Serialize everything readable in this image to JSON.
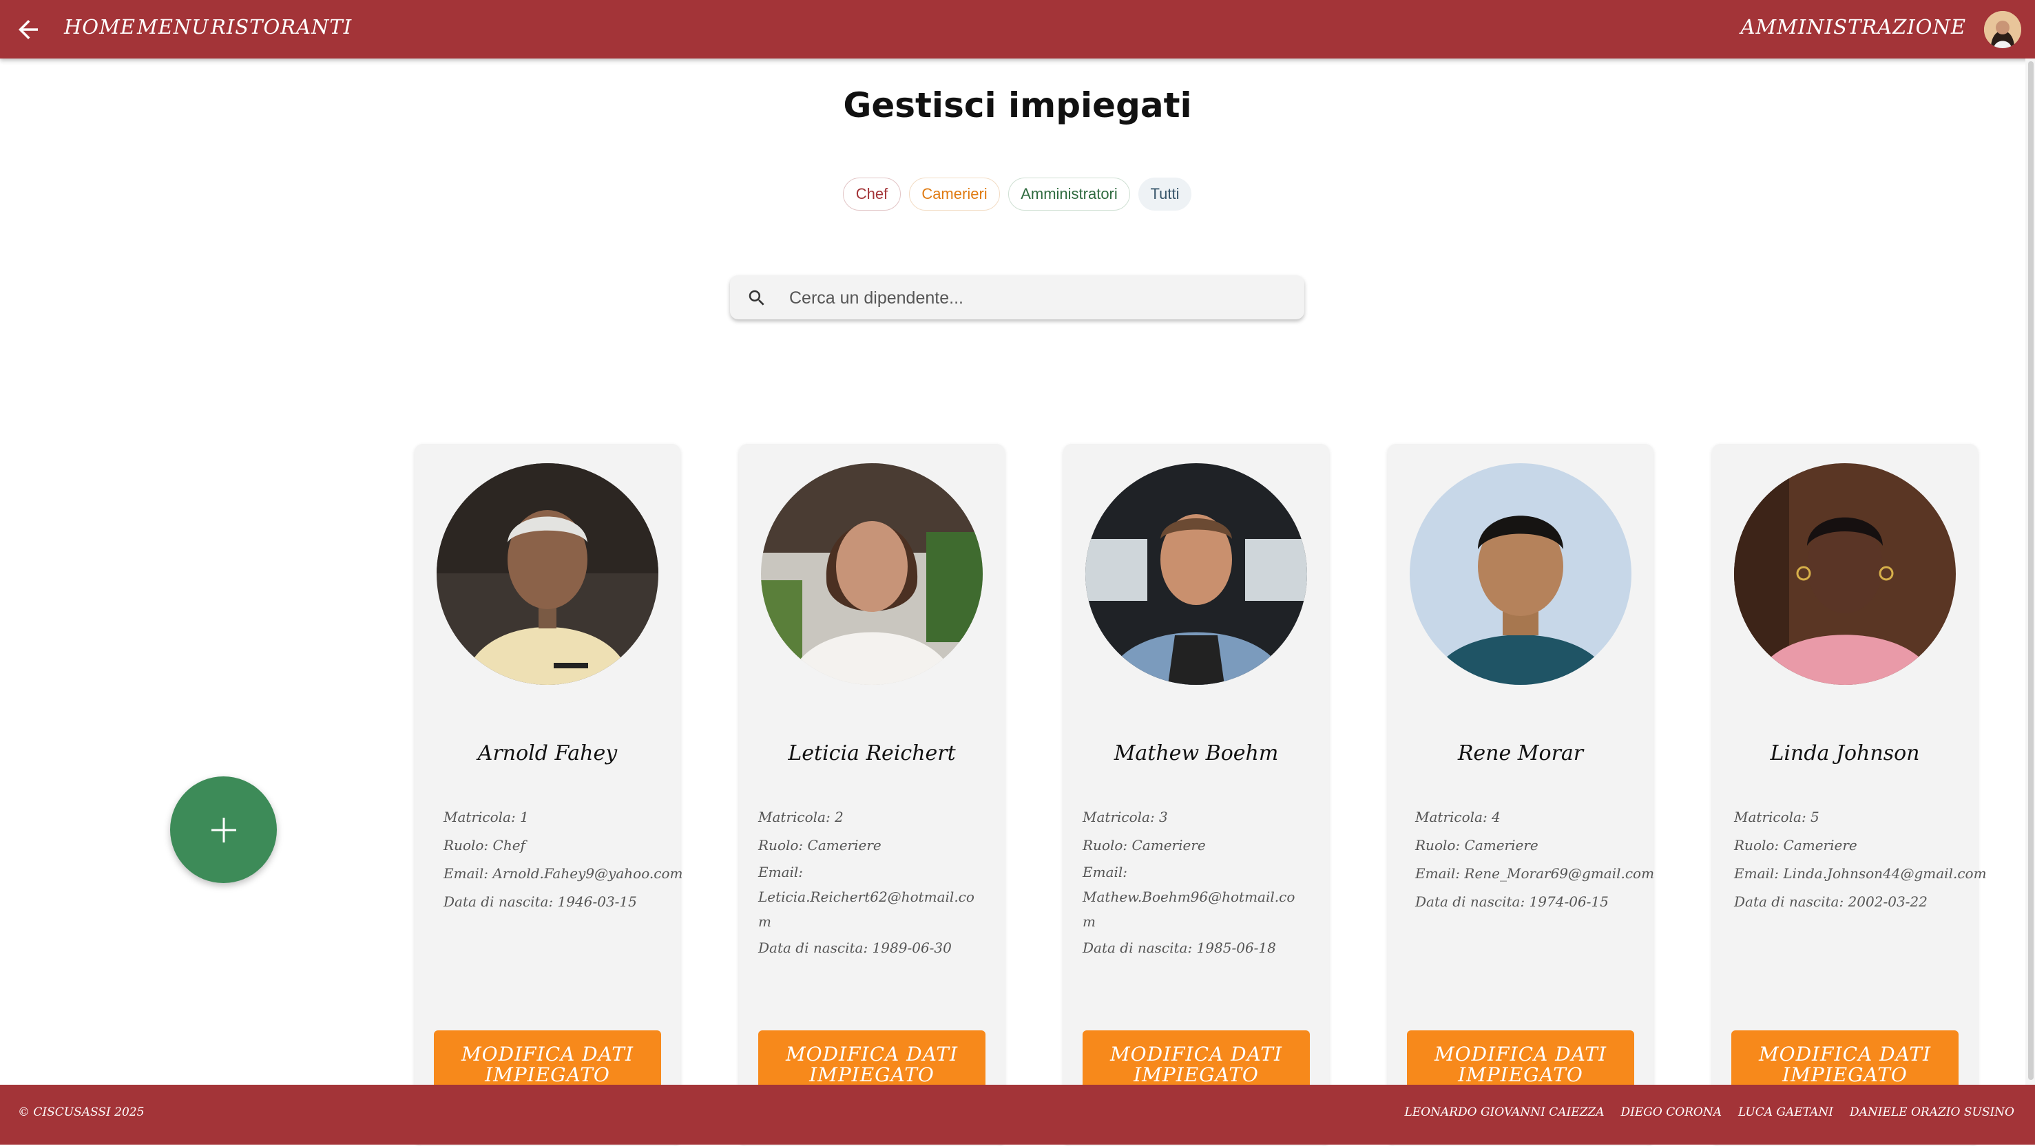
{
  "header": {
    "nav": [
      "HOME",
      "MENU",
      "RISTORANTI"
    ],
    "admin_label": "AMMINISTRAZIONE",
    "bg_color": "#a33438"
  },
  "page": {
    "title": "Gestisci impiegati"
  },
  "filters": {
    "chips": [
      "Chef",
      "Camerieri",
      "Amministratori",
      "Tutti"
    ]
  },
  "search": {
    "placeholder": "Cerca un dipendente..."
  },
  "employees": [
    {
      "name": "Arnold Fahey",
      "matricola": "Matricola: 1",
      "ruolo": "Ruolo: Chef",
      "email_label": "Email:",
      "email": "Arnold.Fahey9@yahoo.com",
      "birth": "Data di nascita: 1946-03-15",
      "button": "MODIFICA DATI IMPIEGATO"
    },
    {
      "name": "Leticia Reichert",
      "matricola": "Matricola: 2",
      "ruolo": "Ruolo: Cameriere",
      "email_label": "Email:",
      "email": "Leticia.Reichert62@hotmail.com",
      "birth": "Data di nascita: 1989-06-30",
      "button": "MODIFICA DATI IMPIEGATO"
    },
    {
      "name": "Mathew Boehm",
      "matricola": "Matricola: 3",
      "ruolo": "Ruolo: Cameriere",
      "email_label": "Email:",
      "email": "Mathew.Boehm96@hotmail.com",
      "birth": "Data di nascita: 1985-06-18",
      "button": "MODIFICA DATI IMPIEGATO"
    },
    {
      "name": "Rene Morar",
      "matricola": "Matricola: 4",
      "ruolo": "Ruolo: Cameriere",
      "email_label": "Email:",
      "email": "Rene_Morar69@gmail.com",
      "birth": "Data di nascita: 1974-06-15",
      "button": "MODIFICA DATI IMPIEGATO"
    },
    {
      "name": "Linda Johnson",
      "matricola": "Matricola: 5",
      "ruolo": "Ruolo: Cameriere",
      "email_label": "Email:",
      "email": "Linda.Johnson44@gmail.com",
      "birth": "Data di nascita: 2002-03-22",
      "button": "MODIFICA DATI IMPIEGATO"
    }
  ],
  "footer": {
    "copyright": "© CISCUSASSI 2025",
    "credits": [
      "LEONARDO GIOVANNI CAIEZZA",
      "DIEGO CORONA",
      "LUCA GAETANI",
      "DANIELE ORAZIO SUSINO"
    ]
  },
  "colors": {
    "accent_red": "#a33438",
    "button_orange": "#f7891b",
    "fab_green": "#3d8b58"
  }
}
